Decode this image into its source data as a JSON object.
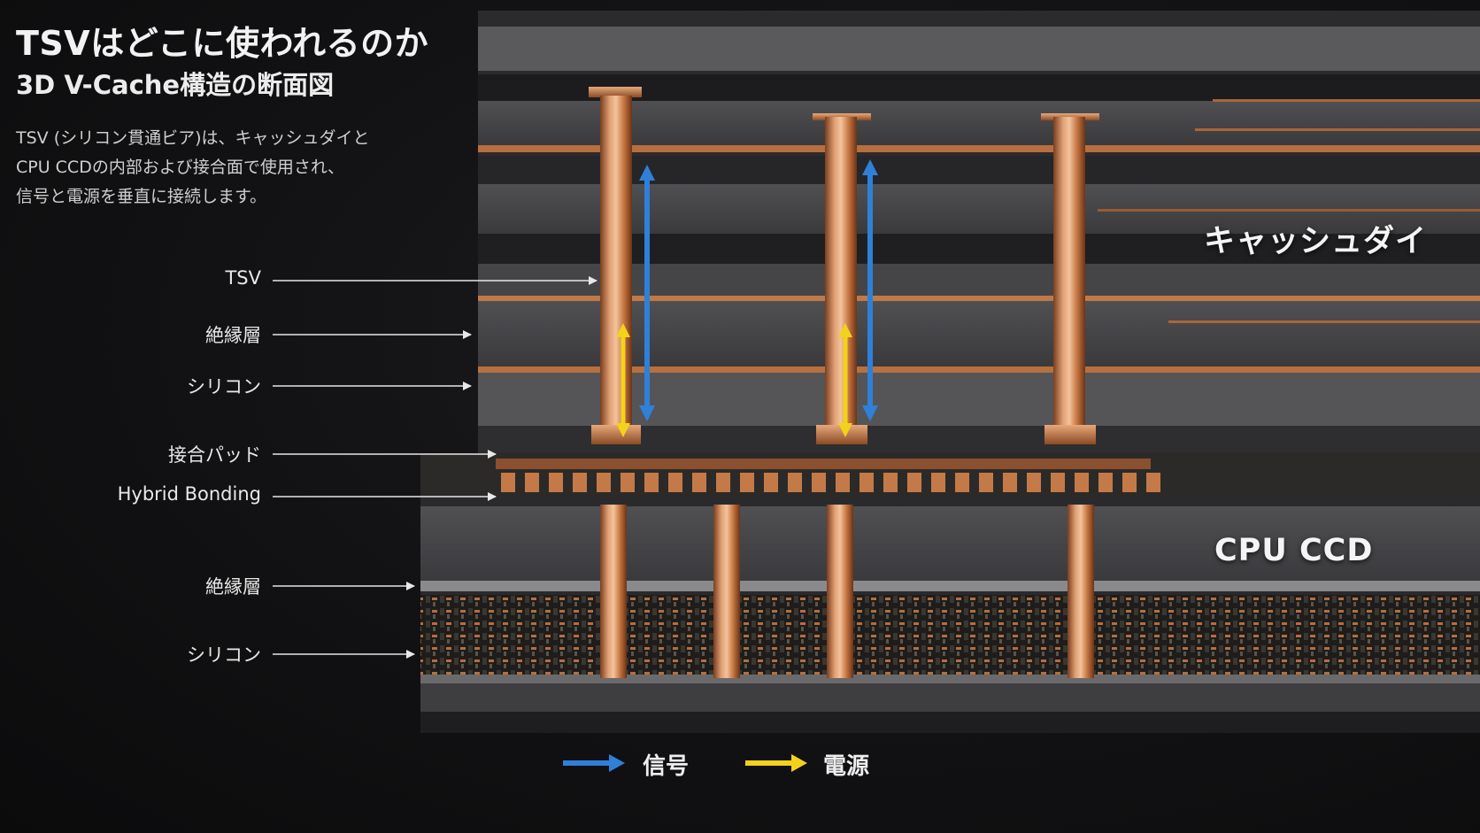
{
  "header": {
    "title": "TSVはどこに使われるのか",
    "subtitle": "3D V-Cache構造の断面図"
  },
  "description": [
    "TSV (シリコン貫通ビア)は、キャッシュダイと",
    "CPU CCDの内部および接合面で使用され、",
    "信号と電源を垂直に接続します。"
  ],
  "labels": {
    "tsv": "TSV",
    "insulation_top": "絶縁層",
    "silicon_top": "シリコン",
    "bonding_pad": "接合パッド",
    "hybrid_bonding": "Hybrid Bonding",
    "insulation_bottom": "絶縁層",
    "silicon_bottom": "シリコン"
  },
  "dies": {
    "cache_die": "キャッシュダイ",
    "cpu_ccd": "CPU CCD"
  },
  "legend": {
    "signal": "信号",
    "power": "電源",
    "signal_color": "#2f80d8",
    "power_color": "#f2d21a"
  },
  "colors": {
    "copper": "#c8784a",
    "copper_light": "#e8a77a",
    "silicon_gray": "#4a4a4c"
  }
}
